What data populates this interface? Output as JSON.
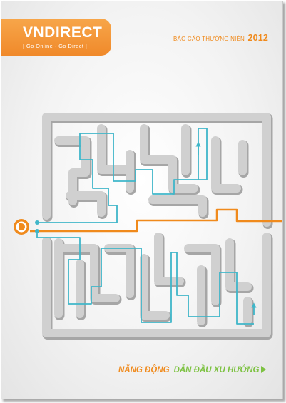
{
  "brand": {
    "name": "VNDIRECT",
    "tagline": "| Go Online - Go Direct |",
    "icon": "d-logo-icon",
    "colors": {
      "orange": "#f08a1c",
      "green": "#7dc242",
      "teal": "#3fb6c9"
    }
  },
  "report": {
    "title": "BÁO CÁO THƯỜNG NIÊN",
    "year": "2012"
  },
  "tagline": {
    "part1": "NĂNG ĐỘNG",
    "part2": "DẪN ĐẦU XU HƯỚNG",
    "icon": "play-arrow-icon"
  }
}
